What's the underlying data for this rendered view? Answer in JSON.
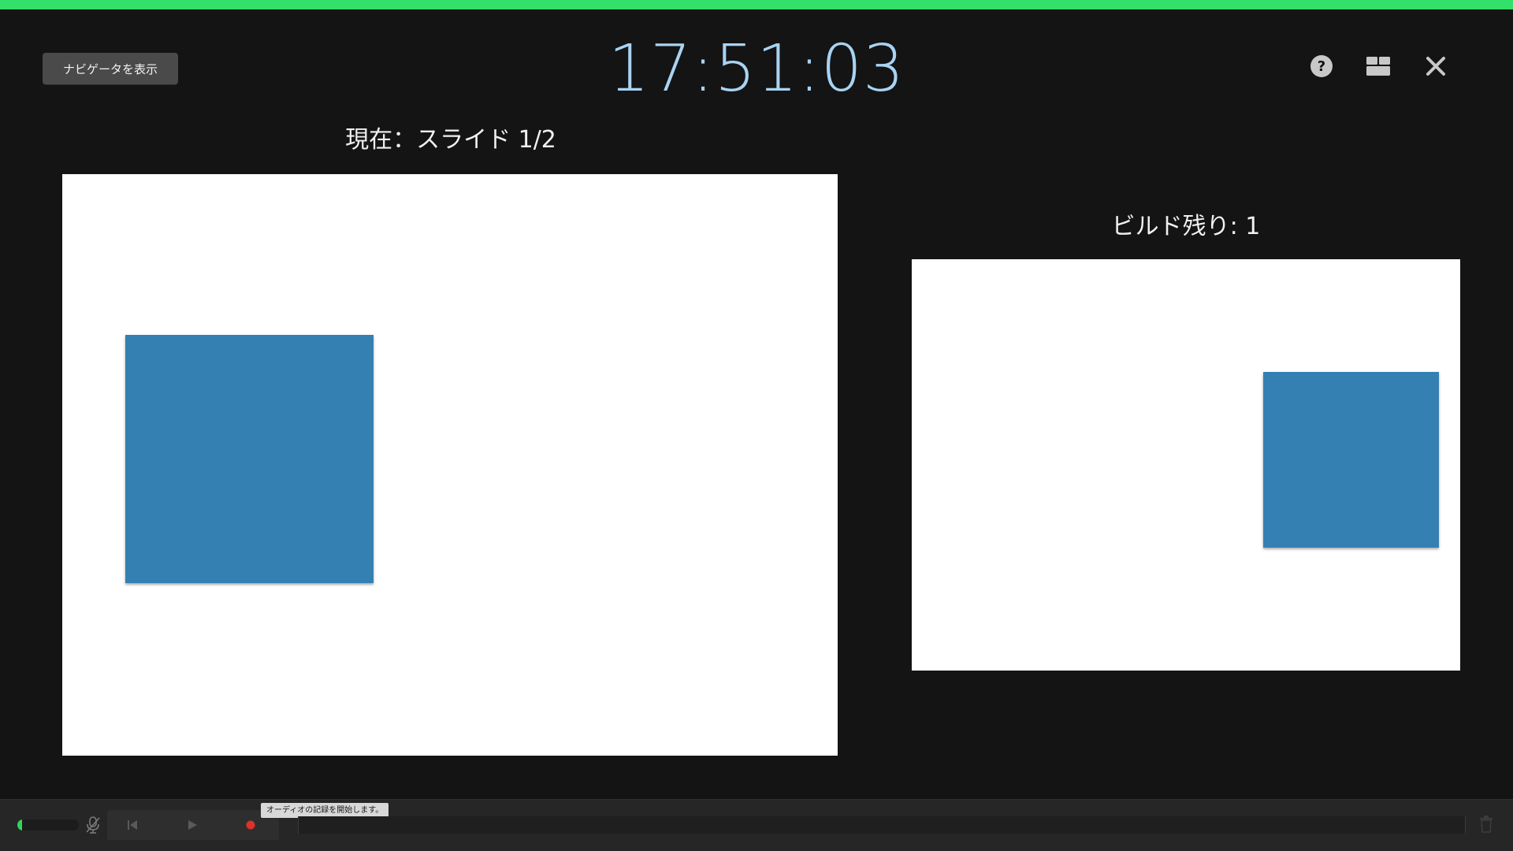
{
  "window": {
    "accent_bar_color": "#33e06a",
    "background_color": "#141414"
  },
  "header": {
    "navigator_button_label": "ナビゲータを表示",
    "clock_time": "17:51:03",
    "clock_color": "#a9d3f2",
    "icons": {
      "help": "help-icon",
      "layout": "layout-icon",
      "close": "close-icon"
    }
  },
  "current_slide": {
    "label": "現在：スライド 1/2",
    "shape_color": "#3580b3"
  },
  "next_slide": {
    "label": "ビルド残り: 1",
    "shape_color": "#3580b3"
  },
  "audio_bar": {
    "level_fraction": 0.08,
    "level_color": "#35d25a",
    "record_color": "#e0302a",
    "tooltip": "オーディオの記録を開始します。",
    "icons": {
      "mic": "microphone-muted-icon",
      "back": "skip-back-icon",
      "play": "play-icon",
      "record": "record-icon",
      "trash": "trash-icon"
    }
  }
}
